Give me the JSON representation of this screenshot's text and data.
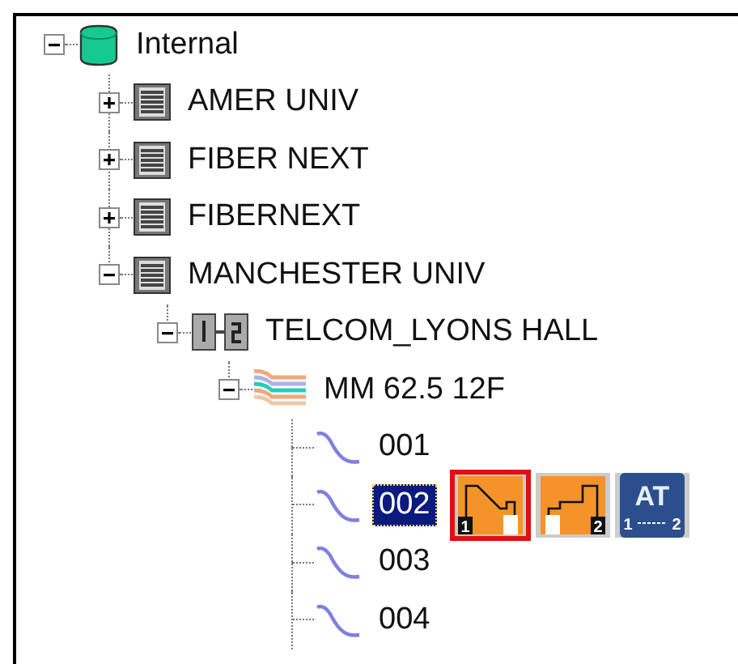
{
  "tree": [
    {
      "label": "Internal",
      "kind": "database",
      "expanded": true,
      "children": [
        {
          "label": "AMER UNIV",
          "kind": "site",
          "expanded": false
        },
        {
          "label": "FIBER NEXT",
          "kind": "site",
          "expanded": false
        },
        {
          "label": "FIBERNEXT",
          "kind": "site",
          "expanded": false
        },
        {
          "label": "MANCHESTER UNIV",
          "kind": "site",
          "expanded": true,
          "children": [
            {
              "label": "TELCOM_LYONS HALL",
              "kind": "panel",
              "expanded": true,
              "children": [
                {
                  "label": "MM 62.5 12F",
                  "kind": "cable",
                  "expanded": true,
                  "children": [
                    {
                      "label": "001",
                      "kind": "fiber",
                      "selected": false
                    },
                    {
                      "label": "002",
                      "kind": "fiber",
                      "selected": true,
                      "actions": [
                        {
                          "kind": "trace-forward",
                          "badge": "1",
                          "selected": true
                        },
                        {
                          "kind": "trace-backward",
                          "badge": "2",
                          "selected": false
                        },
                        {
                          "kind": "auto-test",
                          "label": "AT",
                          "from": "1",
                          "to": "2",
                          "selected": false
                        }
                      ]
                    },
                    {
                      "label": "003",
                      "kind": "fiber",
                      "selected": false
                    },
                    {
                      "label": "004",
                      "kind": "fiber",
                      "selected": false
                    }
                  ]
                }
              ]
            }
          ]
        }
      ]
    }
  ]
}
